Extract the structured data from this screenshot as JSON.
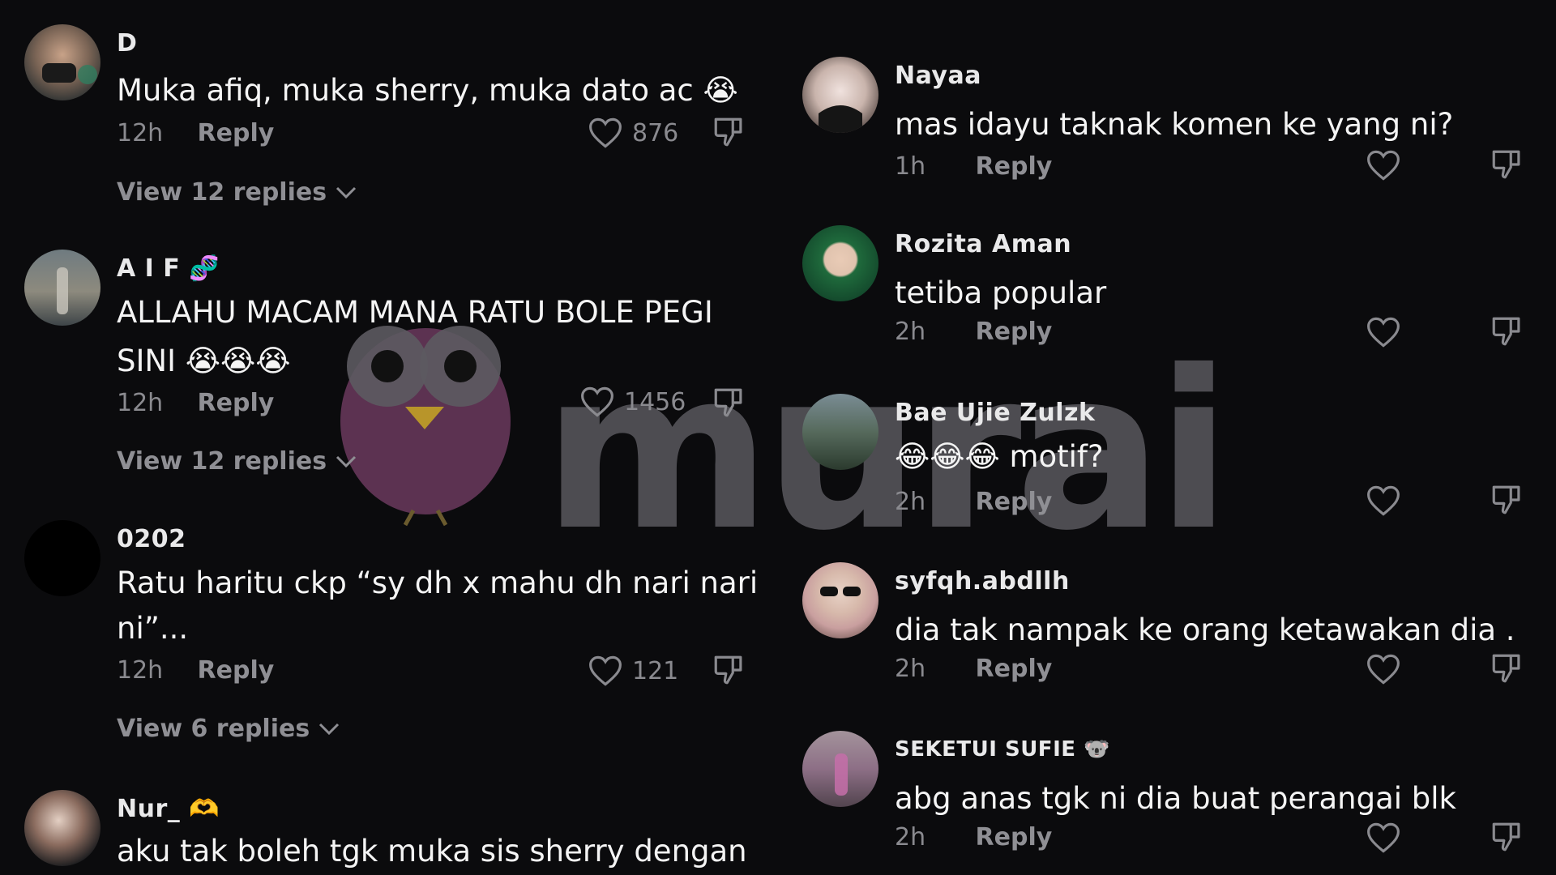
{
  "comments_left": [
    {
      "username": "D",
      "text": "Muka afiq, muka sherry, muka dato ac",
      "emoji": "😭",
      "time": "12h",
      "reply_label": "Reply",
      "likes": "876",
      "view_replies": "View 12 replies"
    },
    {
      "username": "A I F",
      "username_emoji": "🧬",
      "text_line1": "ALLAHU MACAM MANA RATU BOLE PEGI",
      "text_line2": "SINI",
      "text_emojis": "😭😭😭",
      "time": "12h",
      "reply_label": "Reply",
      "likes": "1456",
      "view_replies": "View 12 replies"
    },
    {
      "username": "0202",
      "text_line1": "Ratu haritu ckp “sy dh x mahu dh nari nari",
      "text_line2": "ni”...",
      "time": "12h",
      "reply_label": "Reply",
      "likes": "121",
      "view_replies": "View 6 replies"
    },
    {
      "username": "Nur_",
      "username_emoji": "🫶",
      "text": "aku tak boleh tgk muka sis sherry dengan"
    }
  ],
  "comments_right": [
    {
      "username": "Nayaa",
      "text": "mas idayu taknak komen ke yang ni?",
      "time": "1h",
      "reply_label": "Reply"
    },
    {
      "username": "Rozita Aman",
      "text": "tetiba popular",
      "time": "2h",
      "reply_label": "Reply"
    },
    {
      "username": "Bae Ujie Zulzk",
      "text_emojis": "😂😂😂",
      "text": "motif?",
      "time": "2h",
      "reply_label": "Reply"
    },
    {
      "username": "syfqh.abdllh",
      "text": "dia tak nampak ke orang ketawakan dia .",
      "time": "2h",
      "reply_label": "Reply"
    },
    {
      "username": "SEKETUI SUFIE",
      "username_emoji": "🐨",
      "text": "abg anas tgk ni dia buat perangai blk",
      "time": "2h",
      "reply_label": "Reply"
    }
  ],
  "watermark": {
    "text": "murai"
  },
  "colors": {
    "background": "#0b0b0d",
    "muted": "#8a8a8f",
    "text": "#f4f4f4"
  }
}
